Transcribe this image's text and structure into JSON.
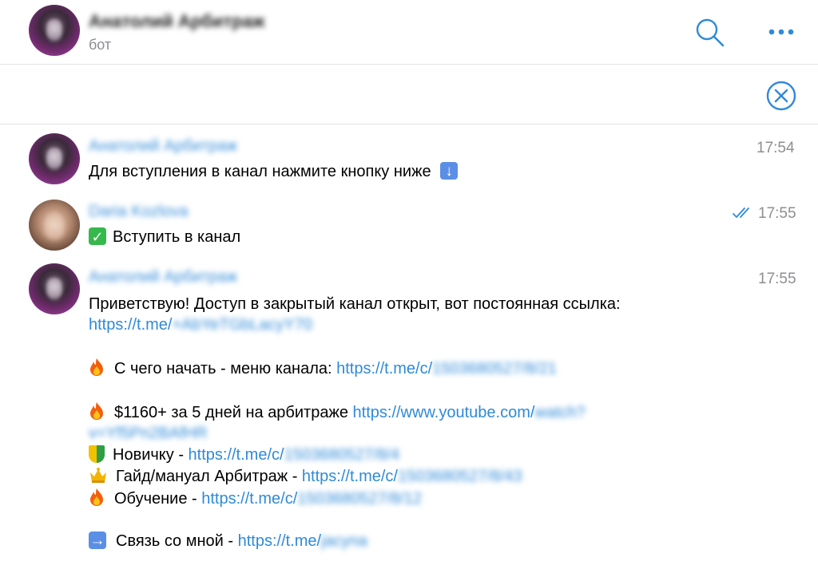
{
  "header": {
    "contact_name": "Анатолий Арбитраж",
    "subtitle": "бот",
    "search_icon": "search-icon",
    "more_icon": "more-icon"
  },
  "pinned_bar": {
    "close_icon": "close-circle-icon"
  },
  "colors": {
    "accent": "#2f8ad8",
    "name_blue": "#3a8fd9",
    "time_gray": "#8e8e93"
  },
  "messages": [
    {
      "sender": "Анатолий Арбитраж",
      "time": "17:54",
      "text": "Для вступления в канал нажмите кнопку ниже",
      "emoji": "down-arrow-emoji"
    },
    {
      "sender": "Daria Kozlova",
      "time": "17:55",
      "status_icon": "double-check-icon",
      "text": "Вступить в канал",
      "emoji": "check-mark-emoji"
    },
    {
      "sender": "Анатолий Арбитраж",
      "time": "17:55",
      "greeting": "Приветствую! Доступ в закрытый канал открыт, вот постоянная ссылка:",
      "link1_visible": "https://t.me/",
      "link1_hidden": "+AbYeTGbLacyY70",
      "line2_label": "С чего начать - меню канала: ",
      "line2_link": "https://t.me/c/",
      "line2_hidden": "1503680527/8/21",
      "line3_label": "$1160+ за 5 дней на арбитраже ",
      "line3_link": "https://www.youtube.com/",
      "line3_hidden_a": "watch?",
      "line3_hidden_b": "v=Yf5Pn2BAfHR",
      "line4_label": "Новичку - ",
      "line4_link": "https://t.me/c/",
      "line4_hidden": "1503680527/8/4",
      "line5_label": "Гайд/мануал Арбитраж - ",
      "line5_link": "https://t.me/c/",
      "line5_hidden": "1503680527/8/43",
      "line6_label": "Обучение - ",
      "line6_link": "https://t.me/c/",
      "line6_hidden": "1503680527/8/12",
      "line7_label": "Связь со мной - ",
      "line7_link": "https://t.me/",
      "line7_hidden": "jacyna"
    }
  ]
}
